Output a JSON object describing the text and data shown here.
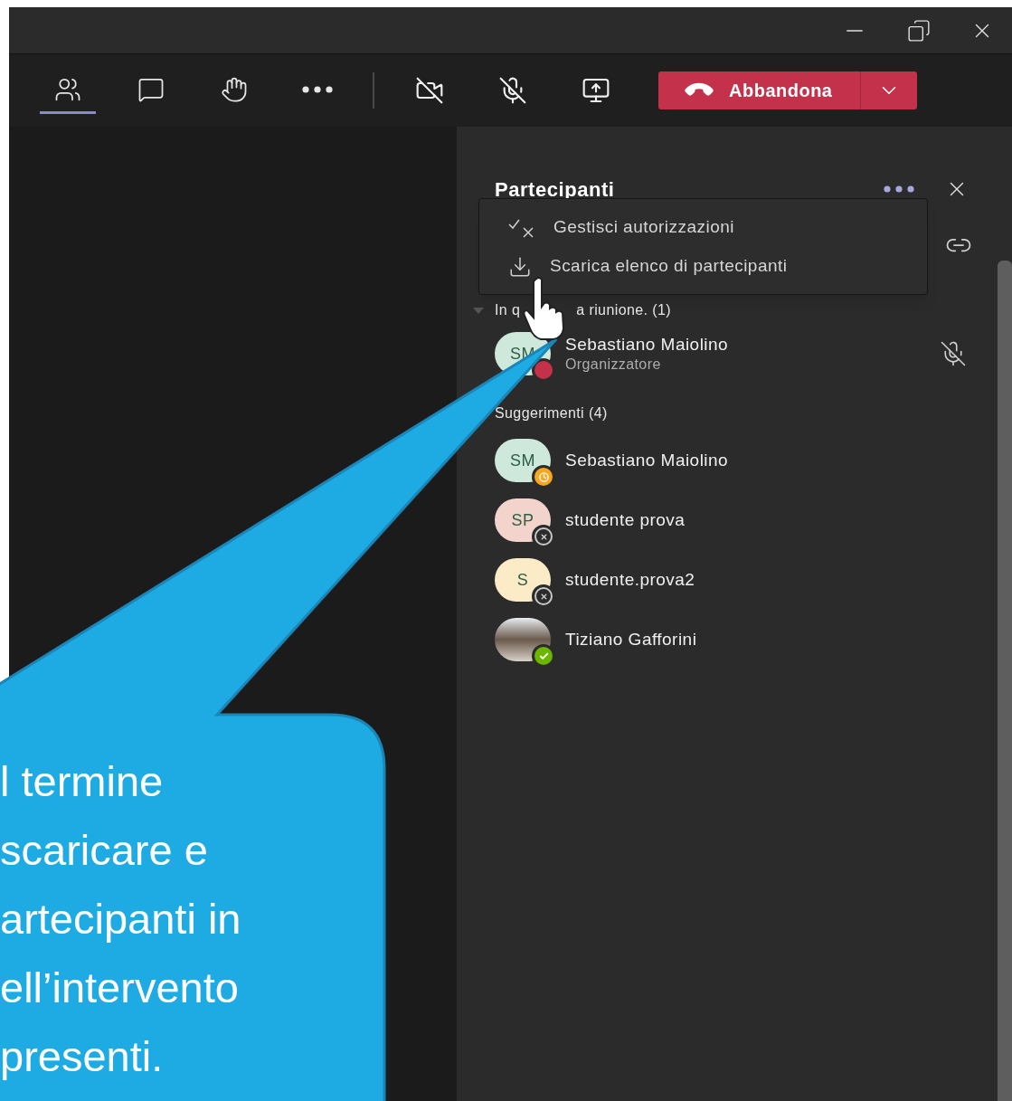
{
  "toolbar": {
    "items": [
      {
        "kind": "people",
        "selected": true
      },
      {
        "kind": "chat",
        "selected": false
      },
      {
        "kind": "hand",
        "selected": false
      },
      {
        "kind": "more",
        "selected": false
      }
    ],
    "media": [
      {
        "kind": "camera-off"
      },
      {
        "kind": "mic-off"
      },
      {
        "kind": "share"
      }
    ],
    "leave_button": {
      "label": "Abbandona"
    }
  },
  "panel": {
    "title": "Partecipanti",
    "menu": [
      {
        "kind": "permissions",
        "label": "Gestisci autorizzazioni"
      },
      {
        "kind": "download",
        "label": "Scarica elenco di partecipanti"
      }
    ],
    "in_meeting": {
      "label_start": "In q",
      "label_end": "a riunione. (1)",
      "expanded": true,
      "people": [
        {
          "initials": "SM",
          "name": "Sebastiano Maiolino",
          "role": "Organizzatore",
          "color": "#cfe8dc",
          "badge": {
            "kind": "busy"
          },
          "muted": true
        }
      ]
    },
    "suggestions": {
      "label": "Suggerimenti (4)",
      "people": [
        {
          "initials": "SM",
          "name": "Sebastiano Maiolino",
          "color": "#cfe8dc",
          "badge": {
            "kind": "away"
          }
        },
        {
          "initials": "SP",
          "name": "studente prova",
          "color": "#f2d4cc",
          "badge": {
            "kind": "offline"
          }
        },
        {
          "initials": "S",
          "name": "studente.prova2",
          "color": "#fbecc7",
          "badge": {
            "kind": "offline"
          }
        },
        {
          "kind": "photo",
          "name": "Tiziano Gafforini",
          "badge": {
            "kind": "available"
          }
        }
      ]
    }
  },
  "callout": {
    "lines": [
      "l termine",
      "scaricare e",
      "artecipanti in",
      "ell’intervento",
      "presenti."
    ]
  }
}
